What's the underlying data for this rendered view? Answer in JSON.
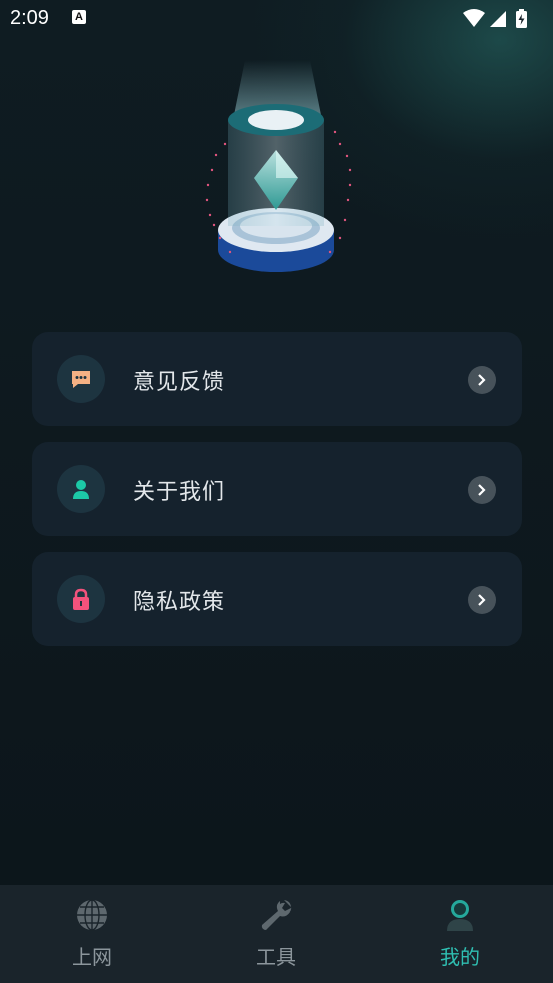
{
  "status_bar": {
    "time": "2:09",
    "notif_icon": "A"
  },
  "menu": [
    {
      "label": "意见反馈",
      "icon": "chat-bubble-icon",
      "icon_color": "#f4b184"
    },
    {
      "label": "关于我们",
      "icon": "user-icon",
      "icon_color": "#1cc9a7"
    },
    {
      "label": "隐私政策",
      "icon": "lock-icon",
      "icon_color": "#f2527c"
    }
  ],
  "bottom_nav": [
    {
      "label": "上网",
      "icon": "globe-icon",
      "active": false
    },
    {
      "label": "工具",
      "icon": "wrench-icon",
      "active": false
    },
    {
      "label": "我的",
      "icon": "profile-icon",
      "active": true
    }
  ],
  "colors": {
    "accent": "#2fbfb2",
    "card": "#15222d",
    "background": "#0d161c"
  }
}
